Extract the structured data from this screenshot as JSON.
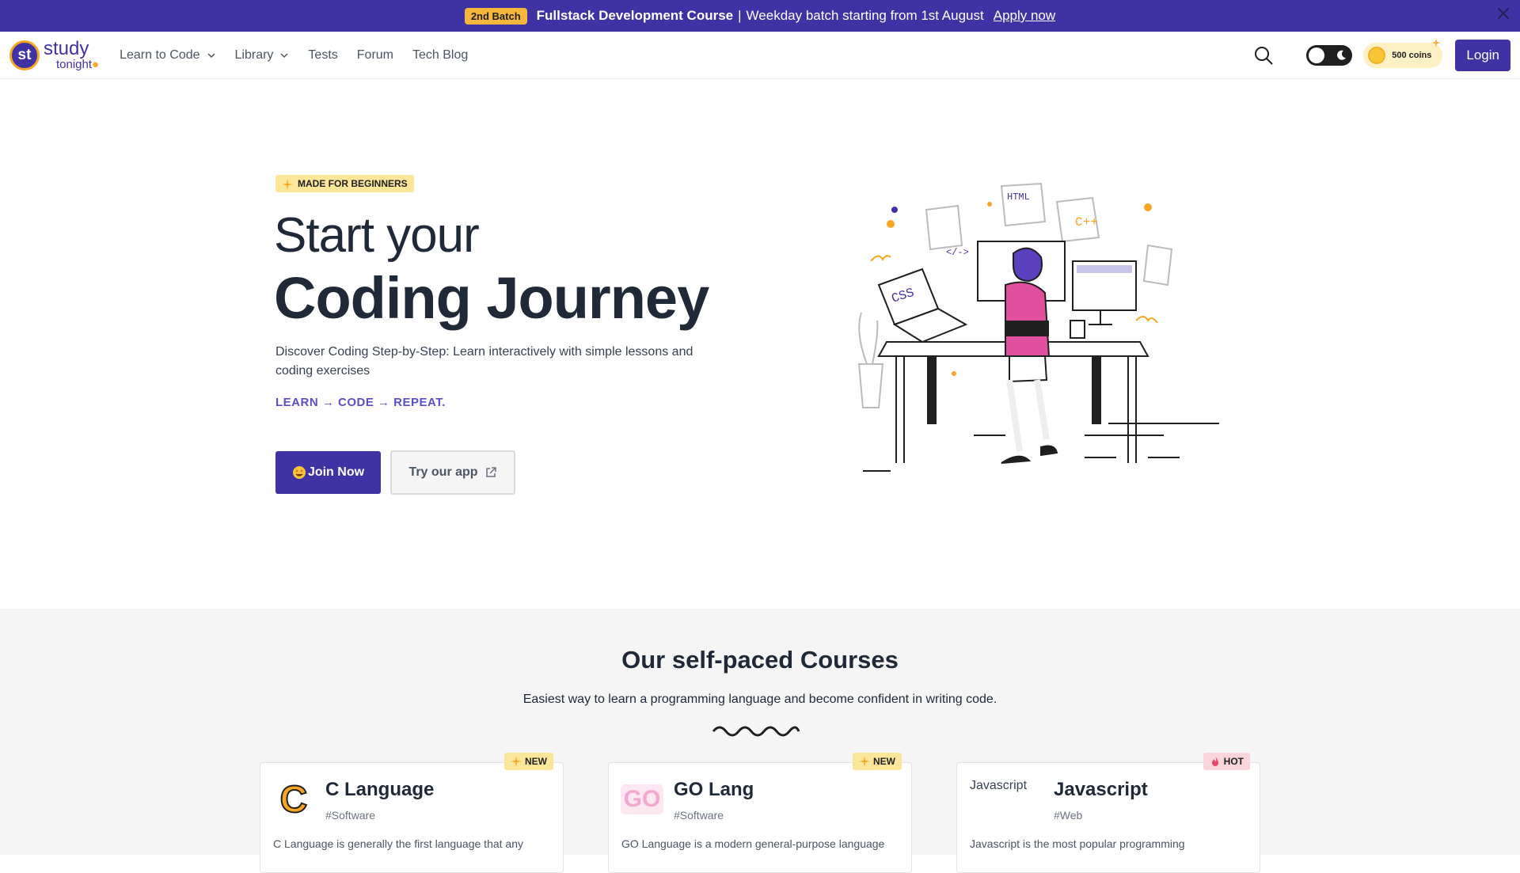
{
  "announcement": {
    "badge": "2nd Batch",
    "course": "Fullstack Development Course",
    "separator": "|",
    "text": "Weekday batch starting from 1st August",
    "link": "Apply now"
  },
  "nav": {
    "logo_line1": "study",
    "logo_line2": "tonight",
    "logo_mark": "st",
    "items": [
      {
        "label": "Learn to Code",
        "dropdown": true
      },
      {
        "label": "Library",
        "dropdown": true
      },
      {
        "label": "Tests",
        "dropdown": false
      },
      {
        "label": "Forum",
        "dropdown": false
      },
      {
        "label": "Tech Blog",
        "dropdown": false
      }
    ],
    "coins_label": "500 coins",
    "login_label": "Login"
  },
  "hero": {
    "badge": "MADE FOR BEGINNERS",
    "title_line1": "Start your",
    "title_line2": "Coding Journey",
    "description": "Discover Coding Step-by-Step: Learn interactively with simple lessons and coding exercises",
    "tagline": "LEARN → CODE → REPEAT.",
    "join_label": "Join Now",
    "app_label": "Try our app",
    "illustration_labels": {
      "html": "HTML",
      "cpp": "C++",
      "css": "CSS",
      "tag": "</->"
    }
  },
  "courses": {
    "title_prefix": "Our self-paced",
    "title_bold": "Courses",
    "subtitle": "Easiest way to learn a programming language and become confident in writing code.",
    "cards": [
      {
        "name": "C Language",
        "tag": "#Software",
        "ribbon": "NEW",
        "logo_text": "C",
        "description": "C Language is generally the first language that any"
      },
      {
        "name": "GO Lang",
        "tag": "#Software",
        "ribbon": "NEW",
        "logo_text": "GO",
        "description": "GO Language is a modern general-purpose language"
      },
      {
        "name": "Javascript",
        "tag": "#Web",
        "ribbon": "HOT",
        "logo_text": "Javascript",
        "description": "Javascript is the most popular programming"
      }
    ]
  },
  "colors": {
    "brand": "#3e32a5",
    "accent": "#f6a623",
    "new_badge": "#fce699",
    "hot_badge": "#fbd5dc",
    "tagline": "#5b4fc8"
  }
}
